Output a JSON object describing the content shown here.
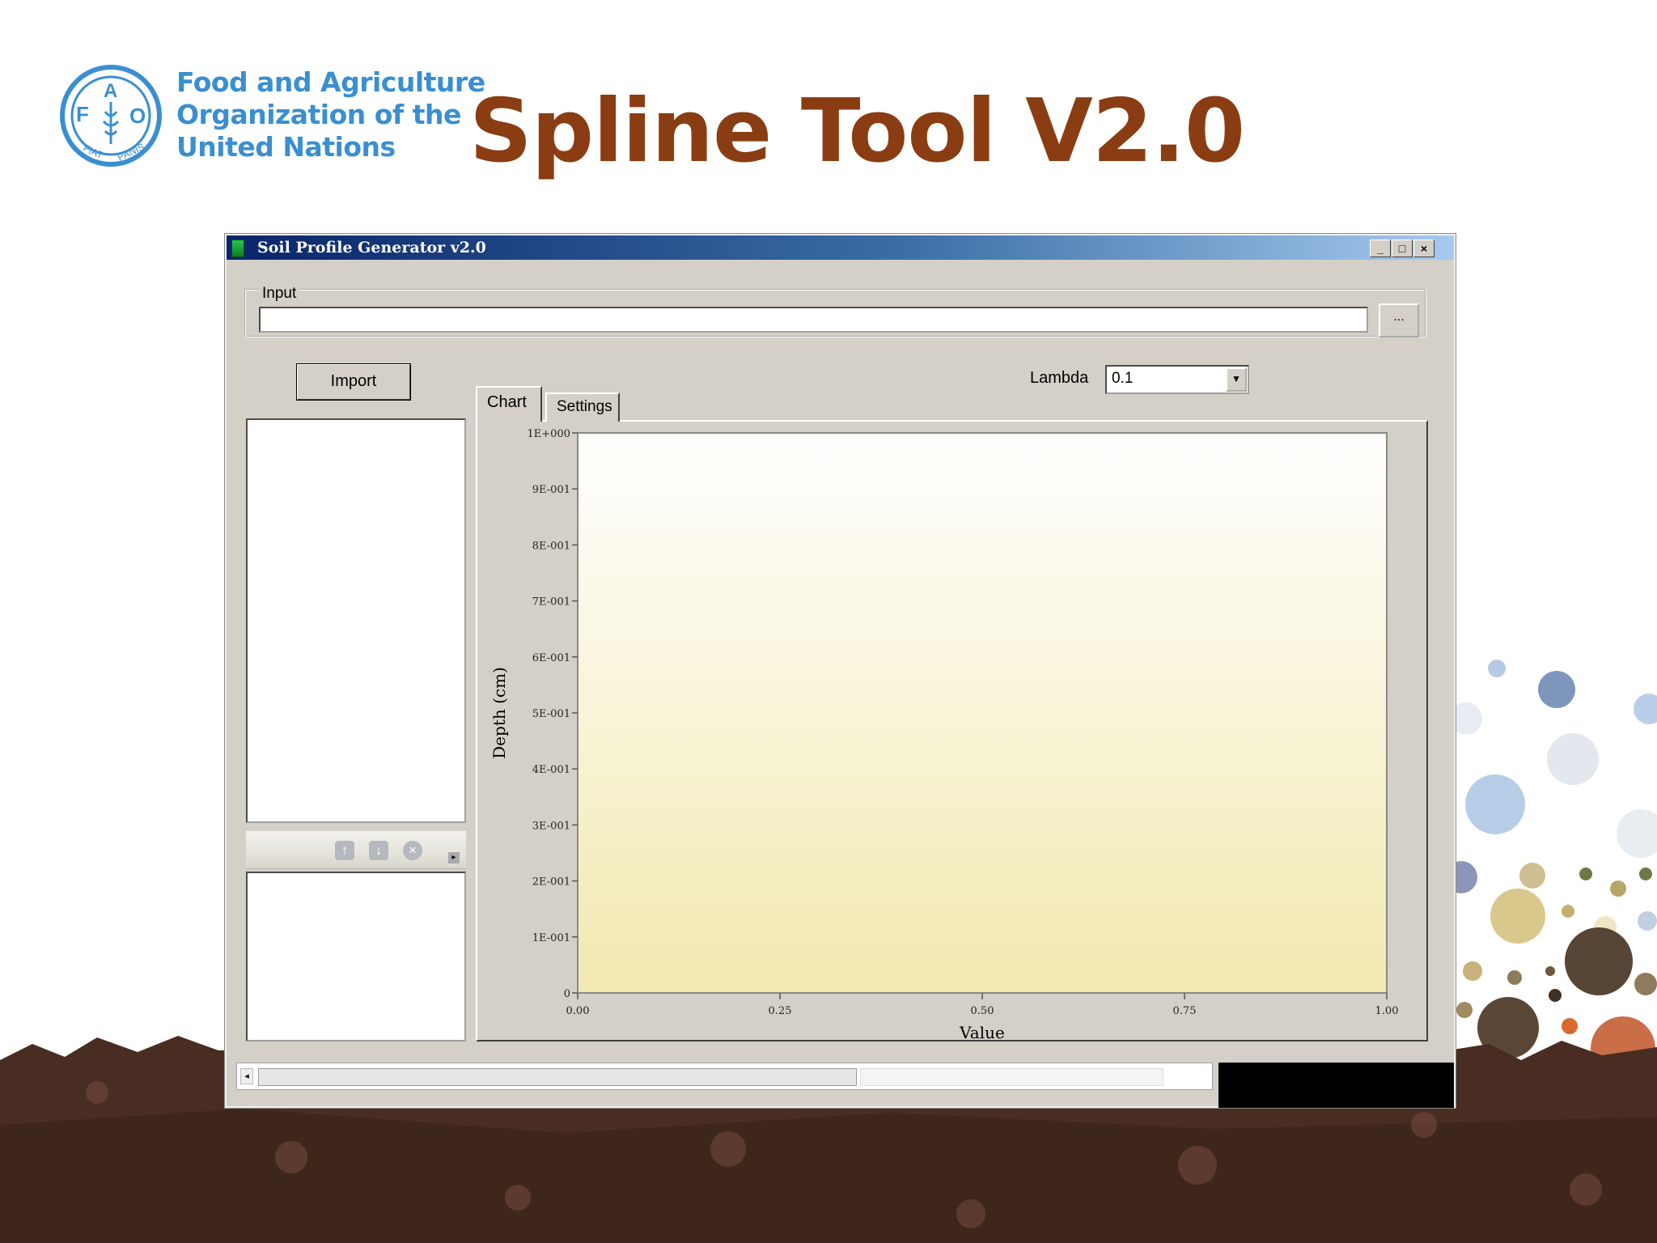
{
  "slide": {
    "org_name_lines": [
      "Food and Agriculture",
      "Organization of the",
      "United Nations"
    ],
    "logo_letters": [
      "F",
      "A",
      "O"
    ],
    "logo_motto": "FIAT PANIS",
    "title": "Spline Tool V2.0"
  },
  "window": {
    "title": "Soil Profile Generator v2.0",
    "controls": {
      "minimize": "_",
      "maximize": "□",
      "close": "×"
    }
  },
  "input_group": {
    "label": "Input",
    "value": "",
    "browse_label": "..."
  },
  "import_button": "Import",
  "lambda": {
    "label": "Lambda",
    "value": "0.1"
  },
  "tabs": [
    {
      "label": "Chart",
      "selected": true
    },
    {
      "label": "Settings",
      "selected": false
    }
  ],
  "list_toolbar_icons": [
    "arrow-up-icon",
    "arrow-down-icon",
    "remove-icon"
  ],
  "chart_data": {
    "type": "line",
    "title": "",
    "xlabel": "Value",
    "ylabel": "Depth (cm)",
    "xlim": [
      0,
      1
    ],
    "ylim": [
      0,
      1
    ],
    "x_ticks": [
      "0.00",
      "0.25",
      "0.50",
      "0.75",
      "1.00"
    ],
    "y_ticks": [
      "0",
      "1E-001",
      "2E-001",
      "3E-001",
      "4E-001",
      "5E-001",
      "6E-001",
      "7E-001",
      "8E-001",
      "9E-001",
      "1E+000"
    ],
    "series": [],
    "plot_background": [
      "#ffffff",
      "#f2e9b0"
    ],
    "grid": false
  },
  "colors": {
    "slide_title": "#8a3d12",
    "org_blue": "#3a8fd0",
    "window_face": "#d4d0c8",
    "titlebar_start": "#0a246a"
  }
}
